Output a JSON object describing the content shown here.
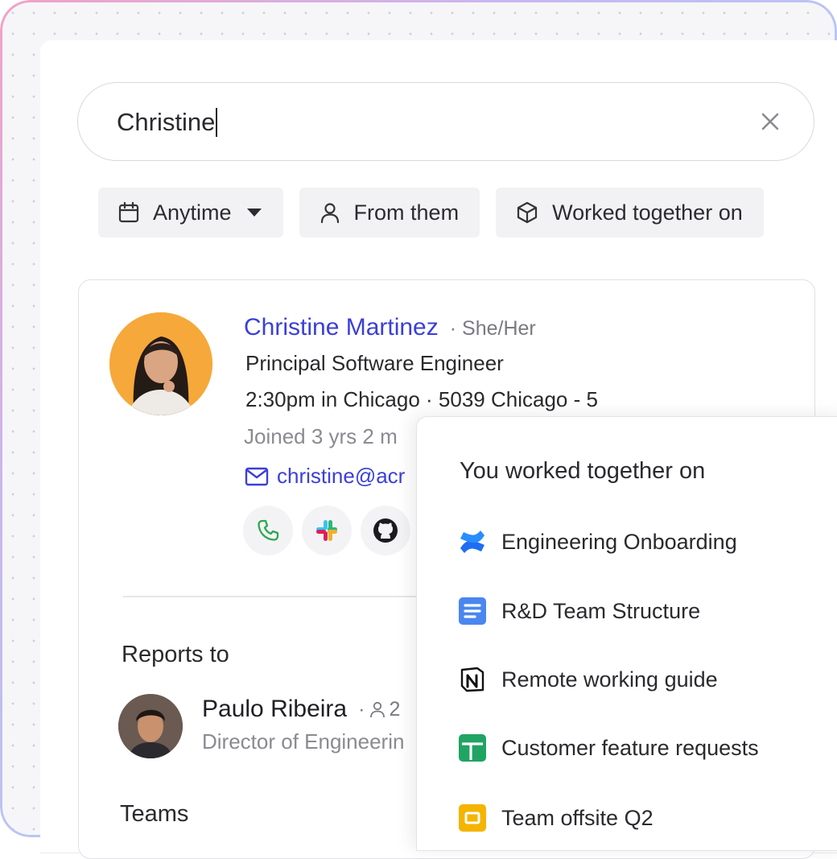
{
  "search": {
    "query": "Christine"
  },
  "filters": {
    "anytime": "Anytime",
    "from_them": "From them",
    "worked_together": "Worked together on"
  },
  "profile": {
    "name": "Christine Martinez",
    "pronouns": "· She/Her",
    "title": "Principal Software Engineer",
    "location": "2:30pm in Chicago · 5039 Chicago - 5",
    "joined": "Joined 3 yrs 2 m",
    "email": "christine@acr",
    "actions": [
      "phone-icon",
      "slack-icon",
      "github-icon"
    ]
  },
  "reports_to": {
    "heading": "Reports to",
    "name": "Paulo Ribeira",
    "reports_count": "2",
    "role": "Director of Engineerin"
  },
  "teams": {
    "heading": "Teams"
  },
  "popover": {
    "title": "You worked together on",
    "items": [
      {
        "label": "Engineering Onboarding",
        "icon": "confluence-icon"
      },
      {
        "label": "R&D Team Structure",
        "icon": "google-docs-icon"
      },
      {
        "label": "Remote working guide",
        "icon": "notion-icon"
      },
      {
        "label": "Customer feature requests",
        "icon": "google-sheets-icon"
      },
      {
        "label": "Team offsite Q2",
        "icon": "google-slides-icon"
      }
    ]
  },
  "colors": {
    "link": "#3b3fd8",
    "avatar_bg": "#f6a83a"
  }
}
